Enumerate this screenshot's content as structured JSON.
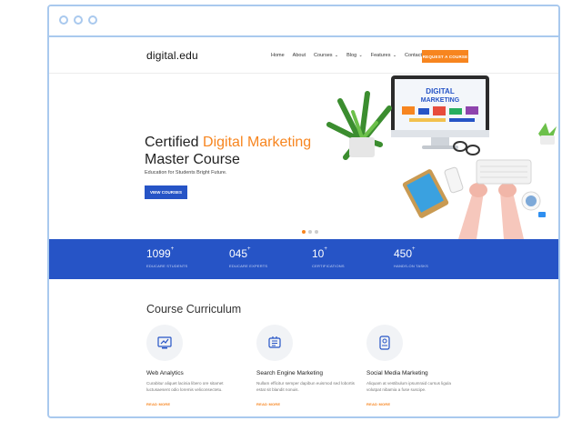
{
  "site": {
    "logo": "digital.edu",
    "nav": [
      {
        "label": "Home",
        "dropdown": false
      },
      {
        "label": "About",
        "dropdown": false
      },
      {
        "label": "Courses",
        "dropdown": true
      },
      {
        "label": "Blog",
        "dropdown": true
      },
      {
        "label": "Features",
        "dropdown": true
      },
      {
        "label": "Contact",
        "dropdown": false
      }
    ],
    "request_button": "REQUEST A COURSE"
  },
  "hero": {
    "title_line1_prefix": "Certified ",
    "title_line1_highlight": "Digital Marketing",
    "title_line2": "Master Course",
    "subtitle": "Education for Students Bright Future.",
    "button": "VIEW COURSES",
    "monitor_line1": "DIGITAL",
    "monitor_line2": "MARKETING",
    "slides_total": 3,
    "slide_active": 1
  },
  "stats": [
    {
      "value": "1099",
      "sup": "+",
      "label": "EDUCARE STUDENTS"
    },
    {
      "value": "045",
      "sup": "+",
      "label": "EDUCARE EXPERTS"
    },
    {
      "value": "10",
      "sup": "+",
      "label": "CERTIFICATIONS"
    },
    {
      "value": "450",
      "sup": "+",
      "label": "HANDS-ON TASKS"
    }
  ],
  "curriculum": {
    "title": "Course Curriculum",
    "courses": [
      {
        "name": "Web Analytics",
        "icon": "analytics-icon",
        "desc": "Curabitur aliquet lacinia libero ore sitamet luctusaesent odio loremis veliconsectetu.",
        "link": "READ MORE"
      },
      {
        "name": "Search Engine Marketing",
        "icon": "search-engine-icon",
        "desc": "Nullam efficitur semper dapibun euismod sed lobortis estat sit blandit nonuis.",
        "link": "READ MORE"
      },
      {
        "name": "Social Media Marketing",
        "icon": "social-media-icon",
        "desc": "Aliquam at vestibulum ipsumraid cursus ligula volutpat nibamia a fuse suscipe.",
        "link": "READ MORE"
      }
    ]
  },
  "colors": {
    "accent": "#f7851f",
    "primary": "#2654c6",
    "frame": "#a9c9ee"
  }
}
